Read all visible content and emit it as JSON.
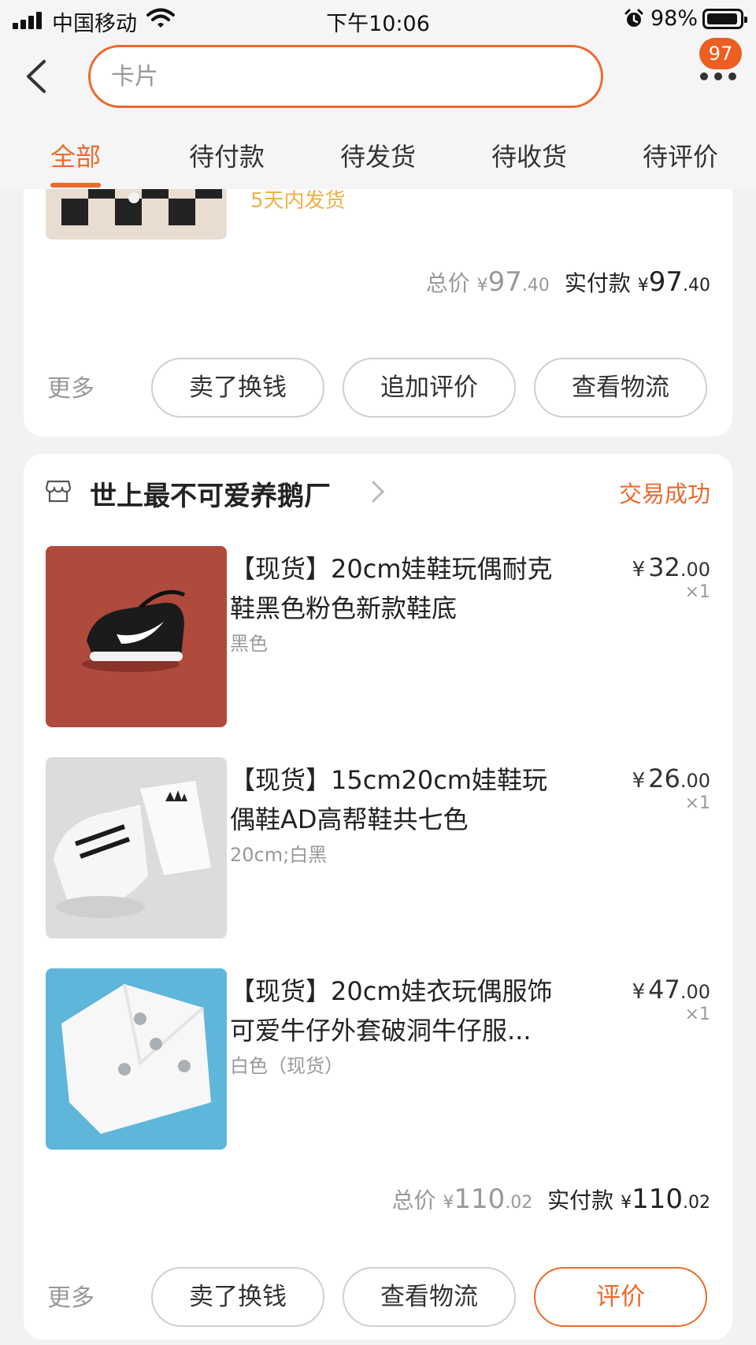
{
  "status_bar": {
    "carrier": "中国移动",
    "time": "下午10:06",
    "battery_pct": "98%"
  },
  "header": {
    "search_placeholder": "卡片",
    "badge_count": "97"
  },
  "tabs": [
    "全部",
    "待付款",
    "待发货",
    "待收货",
    "待评价"
  ],
  "active_tab": 0,
  "order1": {
    "shipping_note": "5天内发货",
    "total_label": "总价",
    "total_yen": "¥",
    "total_int": "97",
    "total_dec": ".40",
    "paid_label": "实付款",
    "paid_yen": "¥",
    "paid_int": "97",
    "paid_dec": ".40",
    "more_label": "更多",
    "buttons": [
      "卖了换钱",
      "追加评价",
      "查看物流"
    ]
  },
  "order2": {
    "shop_name": "世上最不可爱养鹅厂",
    "status": "交易成功",
    "items": [
      {
        "title": "【现货】20cm娃鞋玩偶耐克鞋黑色粉色新款鞋底",
        "sku": "黑色",
        "price_yen": "¥",
        "price_int": "32",
        "price_dec": ".00",
        "qty": "×1"
      },
      {
        "title": "【现货】15cm20cm娃鞋玩偶鞋AD高帮鞋共七色",
        "sku": "20cm;白黑",
        "price_yen": "¥",
        "price_int": "26",
        "price_dec": ".00",
        "qty": "×1"
      },
      {
        "title": "【现货】20cm娃衣玩偶服饰可爱牛仔外套破洞牛仔服...",
        "sku": "白色（现货）",
        "price_yen": "¥",
        "price_int": "47",
        "price_dec": ".00",
        "qty": "×1"
      }
    ],
    "total_label": "总价",
    "total_yen": "¥",
    "total_int": "110",
    "total_dec": ".02",
    "paid_label": "实付款",
    "paid_yen": "¥",
    "paid_int": "110",
    "paid_dec": ".02",
    "more_label": "更多",
    "buttons": [
      "卖了换钱",
      "查看物流",
      "评价"
    ]
  },
  "colors": {
    "accent": "#ec6a2c",
    "shipping_note": "#f0b048",
    "muted": "#999999",
    "background": "#f2f2f2"
  }
}
